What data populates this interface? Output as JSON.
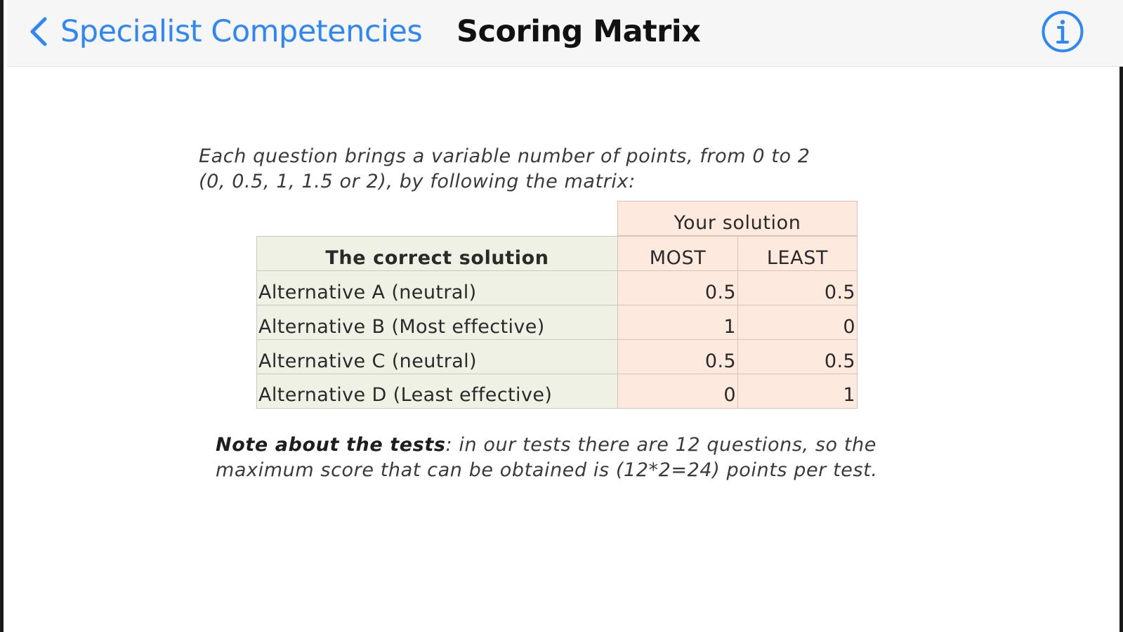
{
  "navbar": {
    "back_label": "Specialist Competencies",
    "title": "Scoring Matrix",
    "back_icon": "chevron-left-icon",
    "info_icon": "info-circle-icon",
    "accent_color": "#2f86f6"
  },
  "intro": {
    "line1": "Each question brings a variable number of points, from 0 to 2",
    "line2": "(0, 0.5, 1, 1.5 or 2), by following the matrix:"
  },
  "matrix": {
    "group_header": "Your solution",
    "row_header": "The correct solution",
    "col_most": "MOST",
    "col_least": "LEAST",
    "rows": [
      {
        "label": "Alternative A (neutral)",
        "most": "0.5",
        "least": "0.5"
      },
      {
        "label": "Alternative B (Most effective)",
        "most": "1",
        "least": "0"
      },
      {
        "label": "Alternative C (neutral)",
        "most": "0.5",
        "least": "0.5"
      },
      {
        "label": "Alternative D (Least effective)",
        "most": "0",
        "least": "1"
      }
    ],
    "colors": {
      "correct_bg": "#eef1e4",
      "yours_bg": "#fde9de"
    }
  },
  "note": {
    "bold_part": "Note about the tests",
    "line1_rest": ": in our tests there are 12 questions, so the",
    "line2": "maximum score that can be obtained is (12*2=24) points per test."
  }
}
